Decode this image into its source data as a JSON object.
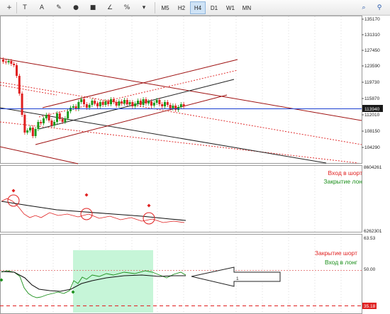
{
  "toolbar": {
    "tools": [
      {
        "name": "crosshair-icon",
        "glyph": "+"
      },
      {
        "name": "text-label-icon",
        "glyph": "T"
      },
      {
        "name": "text-icon",
        "glyph": "A"
      },
      {
        "name": "pencil-icon",
        "glyph": "✎"
      },
      {
        "name": "ellipse-icon",
        "glyph": "●"
      },
      {
        "name": "rectangle-icon",
        "glyph": "■"
      },
      {
        "name": "trendline-icon",
        "glyph": "∠"
      },
      {
        "name": "fibonacci-icon",
        "glyph": "%"
      },
      {
        "name": "dropdown-icon",
        "glyph": "▾"
      }
    ],
    "timeframes": [
      "M5",
      "H2",
      "H4",
      "D1",
      "W1",
      "MN"
    ],
    "active_timeframe": "H4",
    "search_icon": "search-icon",
    "zoom_icon": "zoom-icon"
  },
  "price_panel": {
    "axis_labels": [
      "135170",
      "131310",
      "127450",
      "123590",
      "119730",
      "115870",
      "112010",
      "108150",
      "104290"
    ],
    "current_price": "113940",
    "current_price_color": "#1a3fd1"
  },
  "indicator1": {
    "top_label": "8604261",
    "bottom_label": "6262301",
    "texts": [
      {
        "text": "Вход в шорт",
        "color": "#e02020"
      },
      {
        "text": "Закрытие лон",
        "color": "#1a8f1a"
      }
    ]
  },
  "indicator2": {
    "axis_labels": [
      "63.53",
      "50.00"
    ],
    "bottom_label": "35.18",
    "texts": [
      {
        "text": "Закрытие шорт",
        "color": "#e02020"
      },
      {
        "text": "Вход в лонг",
        "color": "#1a8f1a"
      }
    ],
    "arrow_label": "1"
  },
  "colors": {
    "up_candle": "#1a9a1a",
    "down_candle": "#e02020",
    "channel_red": "#9e1010",
    "channel_dotted": "#e03030",
    "highlight_zone": "#c6f5d8"
  }
}
